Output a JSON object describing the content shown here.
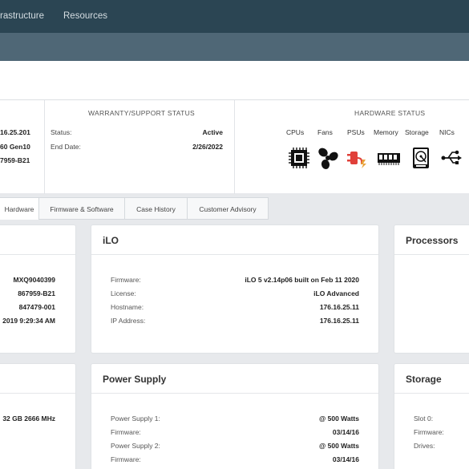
{
  "nav": {
    "items": [
      "rastructure",
      "Resources"
    ]
  },
  "summary": {
    "left_values": [
      "16.25.201",
      "60 Gen10",
      "7959-B21"
    ],
    "warranty": {
      "title": "WARRANTY/SUPPORT STATUS",
      "status_label": "Status:",
      "status_value": "Active",
      "end_label": "End Date:",
      "end_value": "2/26/2022"
    },
    "hardware": {
      "title": "HARDWARE STATUS",
      "labels": [
        "CPUs",
        "Fans",
        "PSUs",
        "Memory",
        "Storage",
        "NICs"
      ],
      "icons": [
        "cpu-icon",
        "fan-icon",
        "power-supply-icon",
        "memory-icon",
        "storage-icon",
        "nic-icon"
      ],
      "alert_color": "#e0403a"
    }
  },
  "tabs": [
    "Hardware",
    "Firmware & Software",
    "Case History",
    "Customer Advisory"
  ],
  "cards": {
    "system": {
      "values": [
        "MXQ9040399",
        "867959-B21",
        "847479-001",
        "2019 9:29:34 AM"
      ]
    },
    "ilo": {
      "title": "iLO",
      "rows": [
        {
          "label": "Firmware:",
          "value": "iLO 5 v2.14p06 built on Feb 11 2020"
        },
        {
          "label": "License:",
          "value": "iLO Advanced"
        },
        {
          "label": "Hostname:",
          "value": "176.16.25.11"
        },
        {
          "label": "IP Address:",
          "value": "176.16.25.11"
        }
      ]
    },
    "processors": {
      "title": "Processors"
    },
    "memory": {
      "values": [
        "32 GB 2666 MHz"
      ]
    },
    "power": {
      "title": "Power Supply",
      "rows": [
        {
          "label": "Power Supply 1:",
          "value": "@ 500 Watts"
        },
        {
          "label": "Firmware:",
          "value": "03/14/16"
        },
        {
          "label": "Power Supply 2:",
          "value": "@ 500 Watts"
        },
        {
          "label": "Firmware:",
          "value": "03/14/16"
        }
      ]
    },
    "storage": {
      "title": "Storage",
      "rows": [
        {
          "label": "Slot 0:"
        },
        {
          "label": "Firmware:"
        },
        {
          "label": "Drives:"
        }
      ]
    }
  }
}
